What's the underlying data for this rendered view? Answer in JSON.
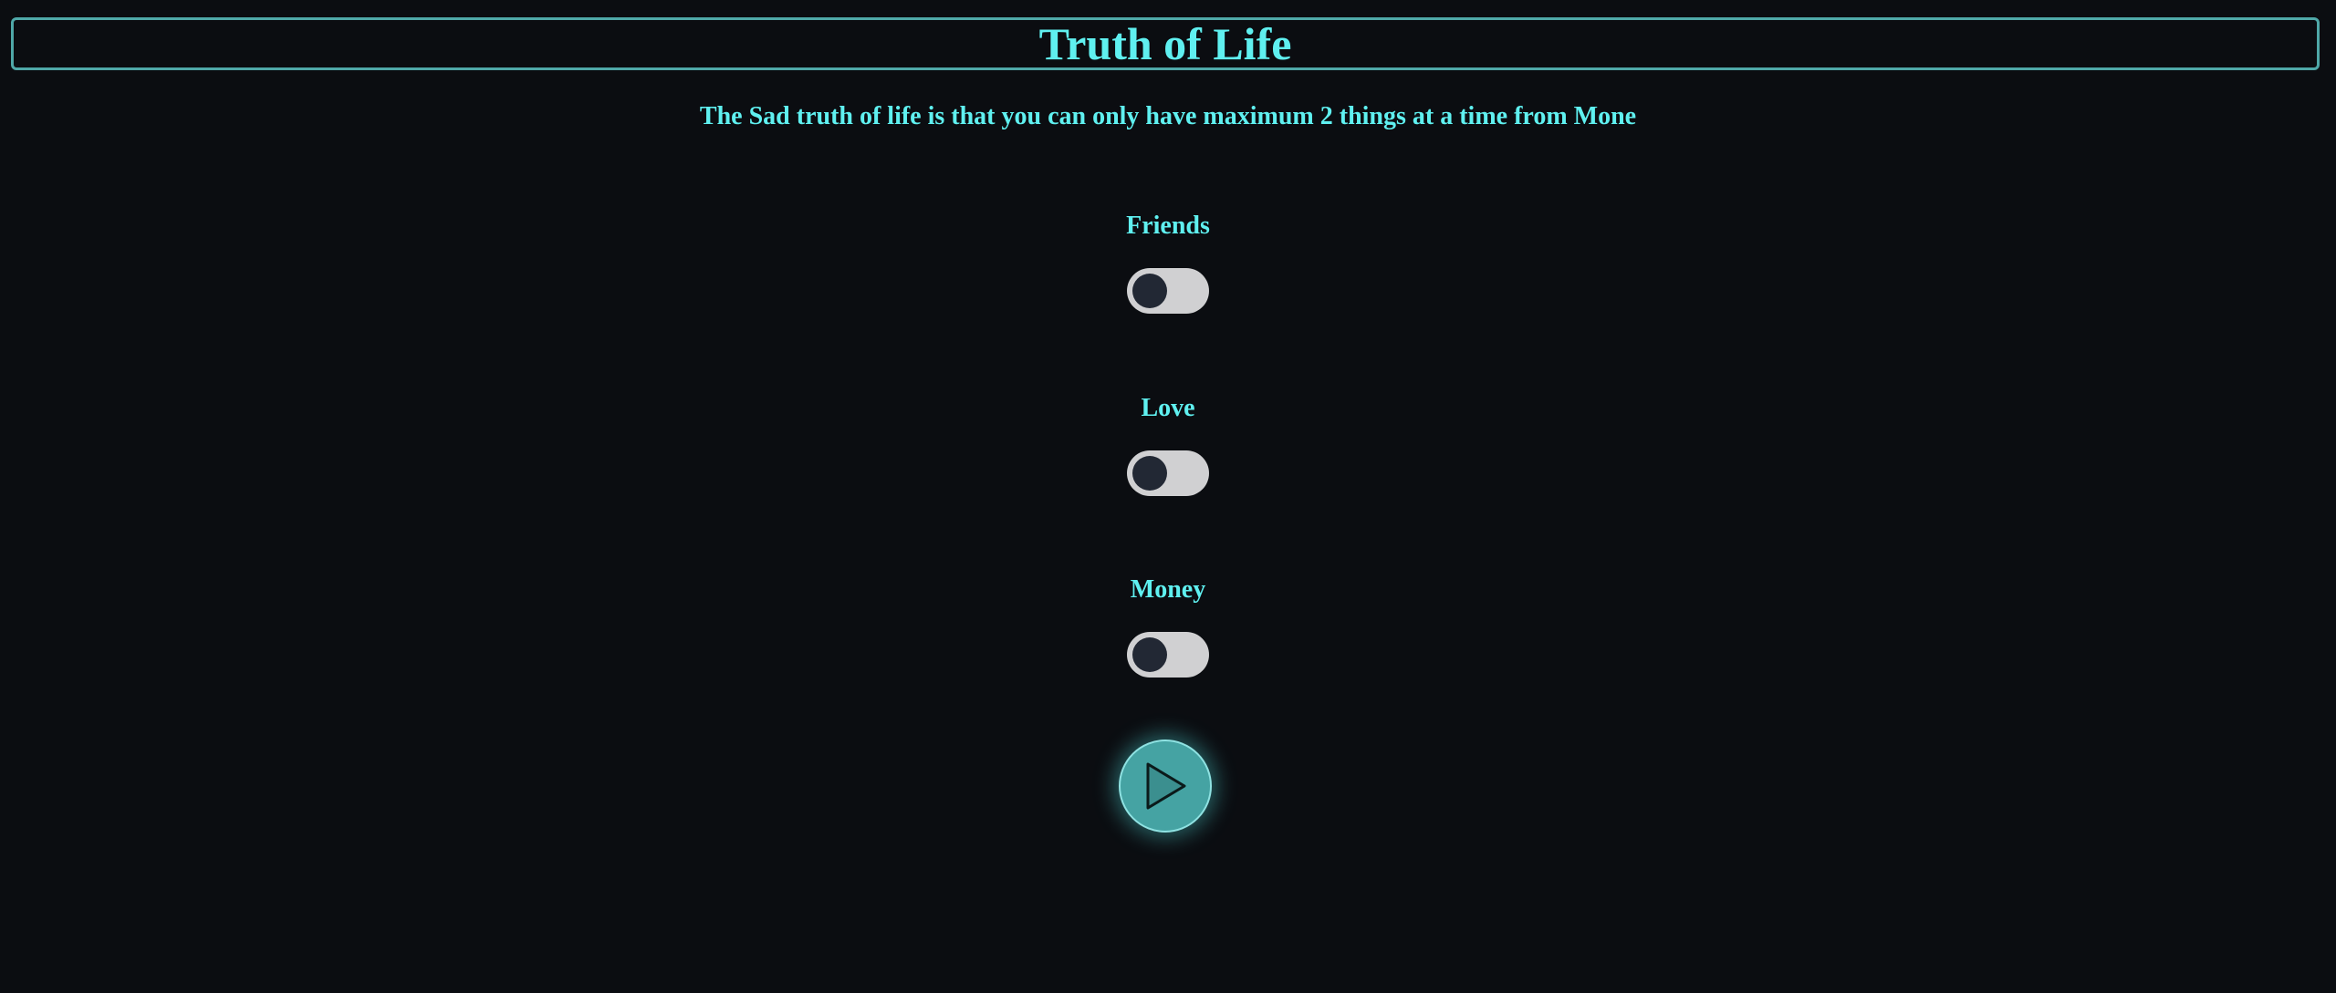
{
  "header": {
    "title": "Truth of Life"
  },
  "subtitle": "The Sad truth of life is that you can only have maximum 2 things at a time from Mone",
  "options": [
    {
      "label": "Friends",
      "checked": false
    },
    {
      "label": "Love",
      "checked": false
    },
    {
      "label": "Money",
      "checked": false
    }
  ],
  "play_button": {
    "icon": "play-icon"
  },
  "colors": {
    "background": "#0b0d11",
    "accent_text": "#5ff0f0",
    "border": "#4fa8a8",
    "toggle_track": "#d0d0d2",
    "toggle_knob": "#222834",
    "play_fill": "#45a3a3"
  }
}
